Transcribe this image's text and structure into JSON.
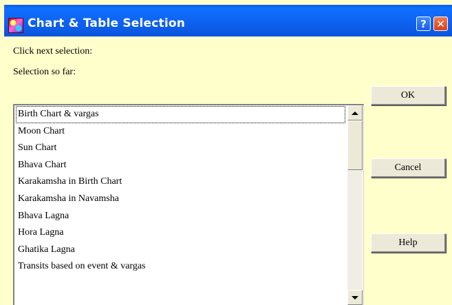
{
  "window": {
    "title": "Chart & Table Selection",
    "help_label": "?",
    "close_label": "✕"
  },
  "labels": {
    "click_next": "Click next selection:",
    "selection_so_far": "Selection so far:"
  },
  "buttons": {
    "ok": "OK",
    "cancel": "Cancel",
    "help": "Help"
  },
  "list": {
    "items": [
      "Birth Chart & vargas",
      "Moon Chart",
      "Sun Chart",
      "Bhava Chart",
      "Karakamsha in Birth Chart",
      "Karakamsha in Navamsha",
      "Bhava Lagna",
      "Hora Lagna",
      "Ghatika Lagna",
      "Transits based on event & vargas"
    ],
    "focused_index": 0
  },
  "colors": {
    "dialog_background": "#ffffcc",
    "titlebar": "#0e62f0",
    "button_face": "#ece9d8"
  }
}
